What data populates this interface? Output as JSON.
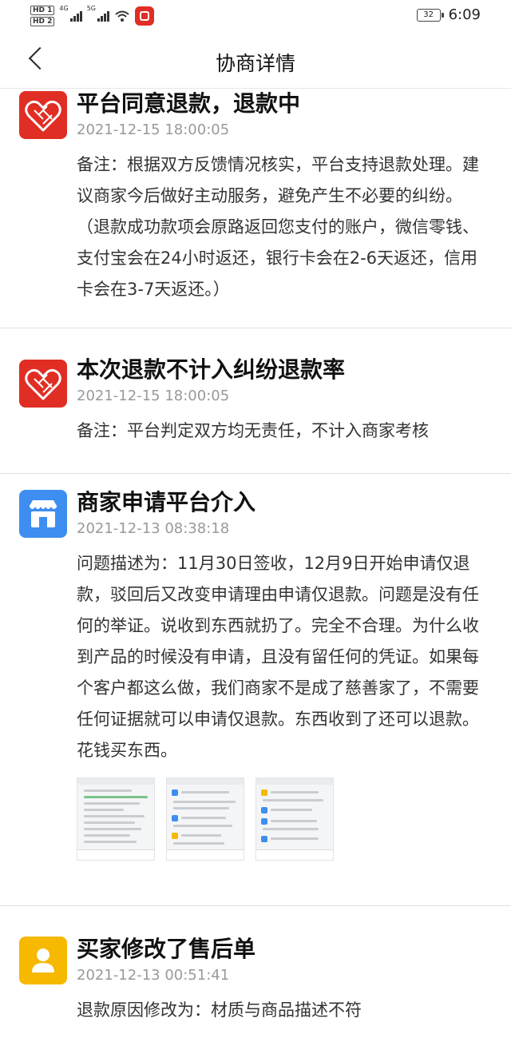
{
  "status_bar": {
    "hd1": "HD 1",
    "hd2": "HD 2",
    "net1": "4G",
    "net2": "5G",
    "battery": "32",
    "time": "6:09"
  },
  "header": {
    "title": "协商详情"
  },
  "entries": [
    {
      "title": "平台同意退款，退款中",
      "time": "2021-12-15 18:00:05",
      "body": "备注：根据双方反馈情况核实，平台支持退款处理。建议商家今后做好主动服务，避免产生不必要的纠纷。（退款成功款项会原路返回您支付的账户，微信零钱、支付宝会在24小时返还，银行卡会在2-6天返还，信用卡会在3-7天返还。）",
      "avatar_icon": "platform-logo-icon",
      "avatar_color": "#e02e24"
    },
    {
      "title": "本次退款不计入纠纷退款率",
      "time": "2021-12-15 18:00:05",
      "body": "备注：平台判定双方均无责任，不计入商家考核",
      "avatar_icon": "platform-logo-icon",
      "avatar_color": "#e02e24"
    },
    {
      "title": "商家申请平台介入",
      "time": "2021-12-13 08:38:18",
      "body": "问题描述为：11月30日签收，12月9日开始申请仅退款，驳回后又改变申请理由申请仅退款。问题是没有任何的举证。说收到东西就扔了。完全不合理。为什么收到产品的时候没有申请，且没有留任何的凭证。如果每个客户都这么做，我们商家不是成了慈善家了，不需要任何证据就可以申请仅退款。东西收到了还可以退款。花钱买东西。",
      "avatar_icon": "store-icon",
      "avatar_color": "#3d8ef0",
      "attachments": [
        "attachment-screenshot-1",
        "attachment-screenshot-2",
        "attachment-screenshot-3"
      ]
    },
    {
      "title": "买家修改了售后单",
      "time": "2021-12-13 00:51:41",
      "body": "退款原因修改为：材质与商品描述不符",
      "avatar_icon": "user-icon",
      "avatar_color": "#f6b800"
    }
  ]
}
